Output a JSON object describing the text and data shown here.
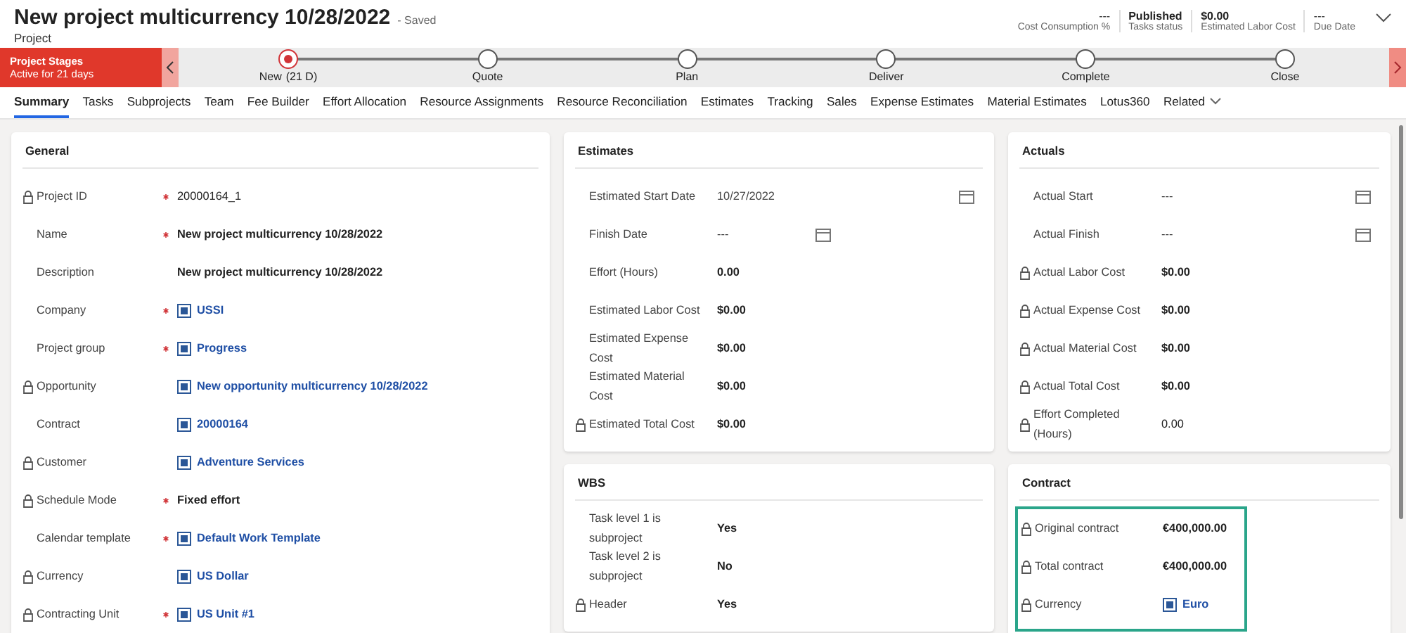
{
  "header": {
    "title": "New project multicurrency 10/28/2022",
    "save_state": "- Saved",
    "subtitle": "Project",
    "stats": [
      {
        "value": "---",
        "label": "Cost Consumption %",
        "bold": false
      },
      {
        "value": "Published",
        "label": "Tasks status",
        "bold": true
      },
      {
        "value": "$0.00",
        "label": "Estimated Labor Cost",
        "bold": true
      },
      {
        "value": "---",
        "label": "Due Date",
        "bold": false
      }
    ]
  },
  "stage_bar": {
    "title": "Project Stages",
    "subtitle": "Active for 21 days",
    "stages": [
      {
        "label": "New",
        "duration": "(21 D)",
        "selected": true
      },
      {
        "label": "Quote",
        "selected": false
      },
      {
        "label": "Plan",
        "selected": false
      },
      {
        "label": "Deliver",
        "selected": false
      },
      {
        "label": "Complete",
        "selected": false
      },
      {
        "label": "Close",
        "selected": false
      }
    ]
  },
  "tabs": [
    {
      "label": "Summary",
      "selected": true
    },
    {
      "label": "Tasks",
      "selected": false
    },
    {
      "label": "Subprojects",
      "selected": false
    },
    {
      "label": "Team",
      "selected": false
    },
    {
      "label": "Fee Builder",
      "selected": false
    },
    {
      "label": "Effort Allocation",
      "selected": false
    },
    {
      "label": "Resource Assignments",
      "selected": false
    },
    {
      "label": "Resource Reconciliation",
      "selected": false
    },
    {
      "label": "Estimates",
      "selected": false
    },
    {
      "label": "Tracking",
      "selected": false
    },
    {
      "label": "Sales",
      "selected": false
    },
    {
      "label": "Expense Estimates",
      "selected": false
    },
    {
      "label": "Material Estimates",
      "selected": false
    },
    {
      "label": "Lotus360",
      "selected": false
    },
    {
      "label": "Related",
      "selected": false,
      "kind": "menu"
    }
  ],
  "columns": [
    [
      {
        "title": "General",
        "highlighted": false,
        "fields": [
          {
            "label": "Project ID",
            "locked": true,
            "required": true,
            "value": "20000164_1",
            "kind": "text"
          },
          {
            "label": "Name",
            "locked": false,
            "required": true,
            "value": "New project multicurrency 10/28/2022",
            "kind": "bold"
          },
          {
            "label": "Description",
            "locked": false,
            "required": false,
            "value": "New project multicurrency 10/28/2022",
            "kind": "bold"
          },
          {
            "label": "Company",
            "locked": false,
            "required": true,
            "value": "USSI",
            "kind": "link"
          },
          {
            "label": "Project group",
            "locked": false,
            "required": true,
            "value": "Progress",
            "kind": "link"
          },
          {
            "label": "Opportunity",
            "locked": true,
            "required": false,
            "value": "New opportunity multicurrency 10/28/2022",
            "kind": "link"
          },
          {
            "label": "Contract",
            "locked": false,
            "required": false,
            "value": "20000164",
            "kind": "link"
          },
          {
            "label": "Customer",
            "locked": true,
            "required": false,
            "value": "Adventure Services",
            "kind": "link"
          },
          {
            "label": "Schedule Mode",
            "locked": true,
            "required": true,
            "value": "Fixed effort",
            "kind": "bold"
          },
          {
            "label": "Calendar template",
            "locked": false,
            "required": true,
            "value": "Default Work Template",
            "kind": "link"
          },
          {
            "label": "Currency",
            "locked": true,
            "required": false,
            "value": "US Dollar",
            "kind": "link"
          },
          {
            "label": "Contracting Unit",
            "locked": true,
            "required": true,
            "value": "US Unit #1",
            "kind": "link"
          }
        ]
      }
    ],
    [
      {
        "title": "Estimates",
        "highlighted": false,
        "fields": [
          {
            "label": "Estimated Start Date",
            "locked": false,
            "required": false,
            "value": "10/27/2022",
            "kind": "date"
          },
          {
            "label": "Finish Date",
            "locked": false,
            "required": false,
            "value": "---",
            "kind": "date-short"
          },
          {
            "label": "Effort (Hours)",
            "locked": false,
            "required": false,
            "value": "0.00",
            "kind": "bold"
          },
          {
            "label": "Estimated Labor Cost",
            "locked": false,
            "required": false,
            "value": "$0.00",
            "kind": "bold"
          },
          {
            "label": "Estimated Expense Cost",
            "locked": false,
            "required": false,
            "value": "$0.00",
            "kind": "bold"
          },
          {
            "label": "Estimated Material Cost",
            "locked": false,
            "required": false,
            "value": "$0.00",
            "kind": "bold"
          },
          {
            "label": "Estimated Total Cost",
            "locked": true,
            "required": false,
            "value": "$0.00",
            "kind": "bold"
          }
        ]
      },
      {
        "title": "WBS",
        "highlighted": false,
        "fields": [
          {
            "label": "Task level 1 is subproject",
            "locked": false,
            "required": false,
            "value": "Yes",
            "kind": "bold"
          },
          {
            "label": "Task level 2 is subproject",
            "locked": false,
            "required": false,
            "value": "No",
            "kind": "bold"
          },
          {
            "label": "Header",
            "locked": true,
            "required": false,
            "value": "Yes",
            "kind": "bold"
          }
        ]
      }
    ],
    [
      {
        "title": "Actuals",
        "highlighted": false,
        "fields": [
          {
            "label": "Actual Start",
            "locked": false,
            "required": false,
            "value": "---",
            "kind": "date"
          },
          {
            "label": "Actual Finish",
            "locked": false,
            "required": false,
            "value": "---",
            "kind": "date"
          },
          {
            "label": "Actual Labor Cost",
            "locked": true,
            "required": false,
            "value": "$0.00",
            "kind": "bold"
          },
          {
            "label": "Actual Expense Cost",
            "locked": true,
            "required": false,
            "value": "$0.00",
            "kind": "bold"
          },
          {
            "label": "Actual Material Cost",
            "locked": true,
            "required": false,
            "value": "$0.00",
            "kind": "bold"
          },
          {
            "label": "Actual Total Cost",
            "locked": true,
            "required": false,
            "value": "$0.00",
            "kind": "bold"
          },
          {
            "label": "Effort Completed (Hours)",
            "locked": true,
            "required": false,
            "value": "0.00",
            "kind": "text"
          }
        ]
      },
      {
        "title": "Contract",
        "highlighted": true,
        "fields": [
          {
            "label": "Original contract",
            "locked": true,
            "required": false,
            "value": "€400,000.00",
            "kind": "bold"
          },
          {
            "label": "Total contract",
            "locked": true,
            "required": false,
            "value": "€400,000.00",
            "kind": "bold"
          },
          {
            "label": "Currency",
            "locked": true,
            "required": false,
            "value": "Euro",
            "kind": "link"
          }
        ]
      }
    ]
  ]
}
